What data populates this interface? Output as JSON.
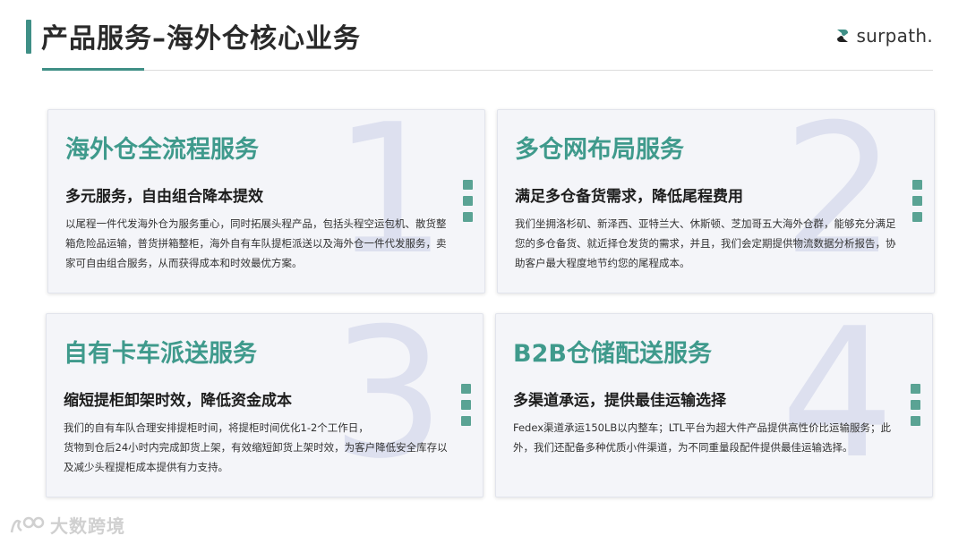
{
  "header": {
    "title": "产品服务–海外仓核心业务",
    "logo_text": "surpath.",
    "accent_color": "#3f8f86"
  },
  "cards": [
    {
      "number": "1",
      "title": "海外仓全流程服务",
      "subtitle": "多元服务，自由组合降本提效",
      "body": [
        "以尾程一件代发海外仓为服务重心，同时拓展头程产品，包括头程空运包机、散货整箱危险品运输，普货拼箱整柜，海外自有车队提柜派送以及海外仓一件代发服务，卖家可自由组合服务，从而获得成本和时效最优方案。"
      ]
    },
    {
      "number": "2",
      "title": "多仓网布局服务",
      "subtitle": "满足多仓备货需求，降低尾程费用",
      "body": [
        "我们坐拥洛杉矶、新泽西、亚特兰大、休斯顿、芝加哥五大海外仓群，能够充分满足您的多仓备货、就近择仓发货的需求，并且，我们会定期提供物流数据分析报告，协助客户最大程度地节约您的尾程成本。"
      ]
    },
    {
      "number": "3",
      "title": "自有卡车派送服务",
      "subtitle": "缩短提柜卸架时效，降低资金成本",
      "body": [
        "我们的自有车队合理安排提柜时间，将提柜时间优化1-2个工作日，",
        "货物到仓后24小时内完成卸货上架，有效缩短卸货上架时效，为客户降低安全库存以及减少头程提柜成本提供有力支持。"
      ]
    },
    {
      "number": "4",
      "title": "B2B仓储配送服务",
      "subtitle": "多渠道承运，提供最佳运输选择",
      "body": [
        "Fedex渠道承运150LB以内整车；LTL平台为超大件产品提供高性价比运输服务；此外，我们还配备多种优质小件渠道，为不同重量段配件提供最佳运输选择。"
      ]
    }
  ],
  "watermark": {
    "text": "大数跨境"
  }
}
